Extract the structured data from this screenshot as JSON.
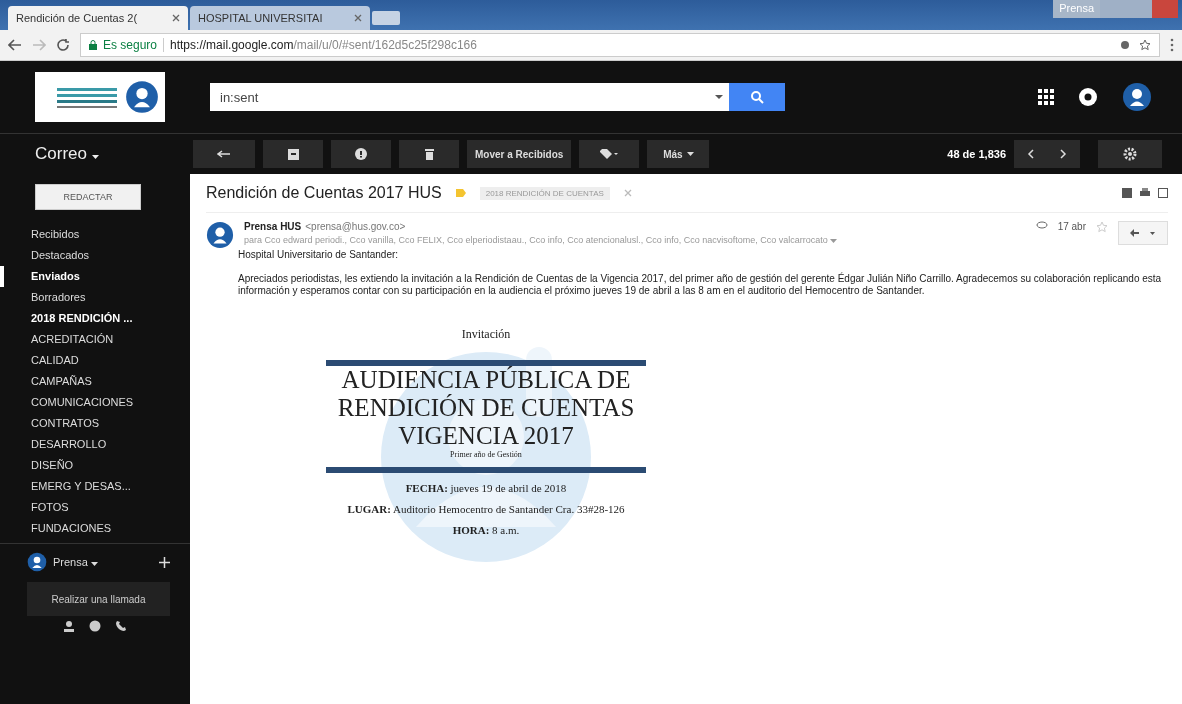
{
  "browser": {
    "tabs": [
      {
        "title": "Rendición de Cuentas 2(",
        "selected": true
      },
      {
        "title": "HOSPITAL UNIVERSITAI",
        "selected": false
      }
    ],
    "profile": "Prensa",
    "address": {
      "secure_label": "Es seguro",
      "host": "https://mail.google.com",
      "path": "/mail/u/0/#sent/162d5c25f298c166"
    }
  },
  "header": {
    "search_value": "in:sent"
  },
  "toolbar": {
    "mail_menu": "Correo",
    "move_button": "Mover a Recibidos",
    "more_button": "Más",
    "counter": "48 de 1,836"
  },
  "sidebar": {
    "compose": "REDACTAR",
    "items": [
      {
        "label": "Recibidos",
        "selected": false,
        "bold": false
      },
      {
        "label": "Destacados",
        "selected": false,
        "bold": false
      },
      {
        "label": "Enviados",
        "selected": true,
        "bold": true
      },
      {
        "label": "Borradores",
        "selected": false,
        "bold": false
      },
      {
        "label": "2018 RENDICIÓN ...",
        "selected": false,
        "bold": true
      },
      {
        "label": "ACREDITACIÓN",
        "selected": false,
        "bold": false
      },
      {
        "label": "CALIDAD",
        "selected": false,
        "bold": false
      },
      {
        "label": "CAMPAÑAS",
        "selected": false,
        "bold": false
      },
      {
        "label": "COMUNICACIONES",
        "selected": false,
        "bold": false
      },
      {
        "label": "CONTRATOS",
        "selected": false,
        "bold": false
      },
      {
        "label": "DESARROLLO",
        "selected": false,
        "bold": false
      },
      {
        "label": "DISEÑO",
        "selected": false,
        "bold": false
      },
      {
        "label": "EMERG Y DESAS...",
        "selected": false,
        "bold": false
      },
      {
        "label": "FOTOS",
        "selected": false,
        "bold": false
      },
      {
        "label": "FUNDACIONES",
        "selected": false,
        "bold": false
      }
    ],
    "account": "Prensa",
    "call_button": "Realizar una llamada"
  },
  "email": {
    "subject": "Rendición de Cuentas 2017 HUS",
    "label_tag": "2018 RENDICIÓN DE CUENTAS",
    "sender_name": "Prensa HUS",
    "sender_email": "<prensa@hus.gov.co>",
    "date": "17 abr",
    "recipients": "para Cco edward periodi., Cco vanilla, Cco FELIX, Cco elperiodistaau., Cco info, Cco atencionalusl., Cco info, Cco nacvisoftome, Cco valcarrocato",
    "greeting": "Hospital Universitario de Santander:",
    "body": "Apreciados periodistas, les extiendo la invitación a la Rendición de Cuentas de la Vigencia 2017, del primer año de gestión del gerente Édgar Julián Niño Carrillo. Agradecemos su colaboración replicando esta información y esperamos contar con su participación en la audiencia el próximo jueves 19 de abril a las 8 am en el auditorio del Hemocentro de Santander.",
    "invitation": {
      "heading": "Invitación",
      "title_lines": [
        "AUDIENCIA PÚBLICA DE",
        "RENDICIÓN DE CUENTAS",
        "VIGENCIA 2017"
      ],
      "subtitle": "Primer año de Gestión",
      "details": [
        "**FECHA:** jueves 19 de abril de 2018",
        "**LUGAR:** Auditorio Hemocentro de Santander Cra. 33#28-126",
        "**HORA:** 8 a.m."
      ]
    }
  }
}
